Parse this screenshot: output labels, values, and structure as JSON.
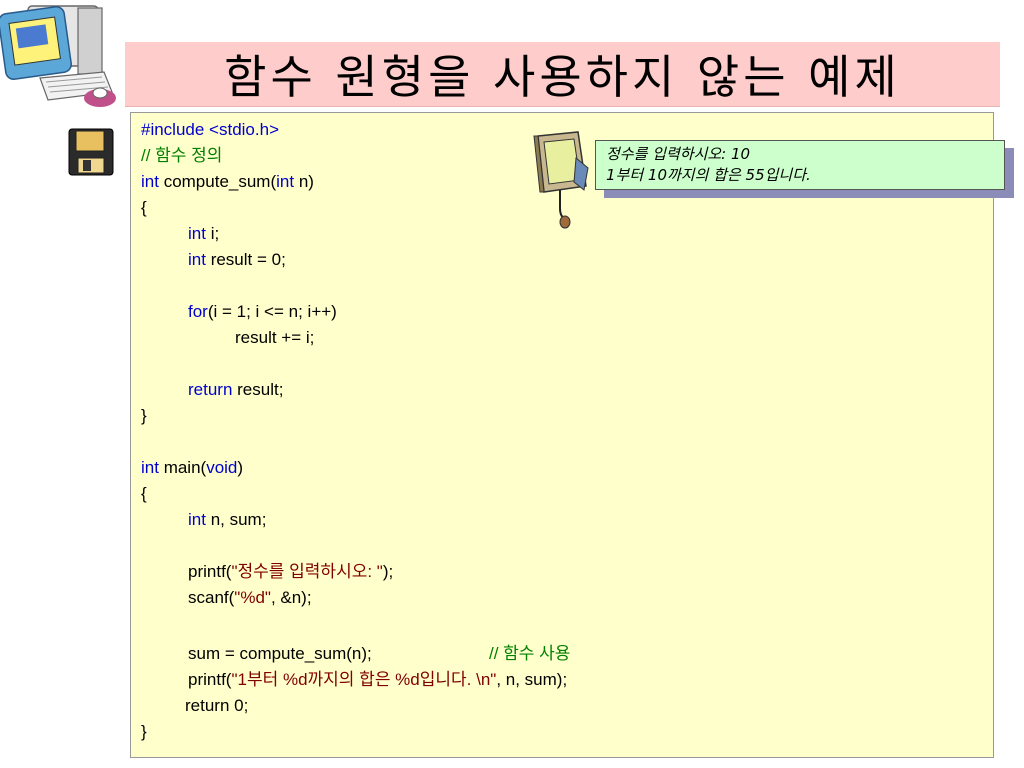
{
  "title": "함수 원형을 사용하지 않는 예제",
  "code": {
    "include": "#include <stdio.h>",
    "comment_def": "// 함수 정의",
    "sig_int": "int",
    "sig_mid": " compute_sum(",
    "sig_int2": "int",
    "sig_end": " n)",
    "brace_open": "{",
    "decl_i_kw": "int",
    "decl_i": " i;",
    "decl_result_kw": "int",
    "decl_result": " result = 0;",
    "for_kw": "for",
    "for_rest": "(i = 1; i <= n; i++)",
    "accum": "result += i;",
    "return_kw": "return",
    "return_rest": " result;",
    "brace_close": "}",
    "main_int": "int",
    "main_mid": " main(",
    "main_void": "void",
    "main_end": ")",
    "main_brace_open": "{",
    "decl_n_kw": "int",
    "decl_n": " n, sum;",
    "printf1_pre": "printf(",
    "printf1_str": "\"정수를 입력하시오: \"",
    "printf1_post": ");",
    "scanf_pre": "scanf(",
    "scanf_str": "\"%d\"",
    "scanf_post": ", &n);",
    "sum_call": "sum = compute_sum(n);",
    "comment_use": "// 함수 사용",
    "printf2_pre": "printf(",
    "printf2_str": "\"1부터 %d까지의 합은 %d입니다. \\n\"",
    "printf2_post": ", n, sum);",
    "return0": "return 0;",
    "main_brace_close": "}"
  },
  "output": {
    "line1": "정수를 입력하시오: 10",
    "line2": "1부터 10까지의 합은 55입니다."
  },
  "colors": {
    "title_bg": "#ffcccc",
    "code_bg": "#ffffcc",
    "keyword": "#0000cc",
    "comment": "#008000",
    "string": "#800000",
    "output_bg": "#ccffcc",
    "output_shadow": "#8c8cb8"
  },
  "icons": [
    "computer-clipart",
    "floppy-disk-icon",
    "monitor-clipart"
  ]
}
